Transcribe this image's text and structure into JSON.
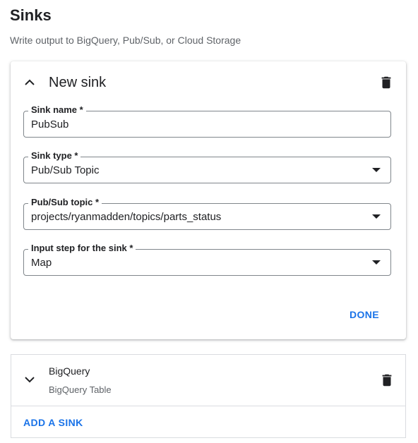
{
  "header": {
    "title": "Sinks",
    "subtitle": "Write output to BigQuery, Pub/Sub, or Cloud Storage"
  },
  "expanded_sink": {
    "title": "New sink",
    "fields": {
      "sink_name": {
        "label": "Sink name *",
        "value": "PubSub"
      },
      "sink_type": {
        "label": "Sink type *",
        "value": "Pub/Sub Topic"
      },
      "pubsub_topic": {
        "label": "Pub/Sub topic *",
        "value": "projects/ryanmadden/topics/parts_status"
      },
      "input_step": {
        "label": "Input step for the sink *",
        "value": "Map"
      }
    },
    "done_label": "DONE"
  },
  "collapsed_sinks": [
    {
      "title": "BigQuery",
      "subtitle": "BigQuery Table"
    }
  ],
  "add_sink_label": "ADD A SINK",
  "icons": {
    "expand_less": "chevron-up-icon",
    "expand_more": "chevron-down-icon",
    "delete": "trash-icon",
    "dropdown": "caret-down-icon"
  },
  "colors": {
    "accent": "#1a73e8",
    "text": "#202124",
    "secondary_text": "#5f6368",
    "border": "#80868b"
  }
}
